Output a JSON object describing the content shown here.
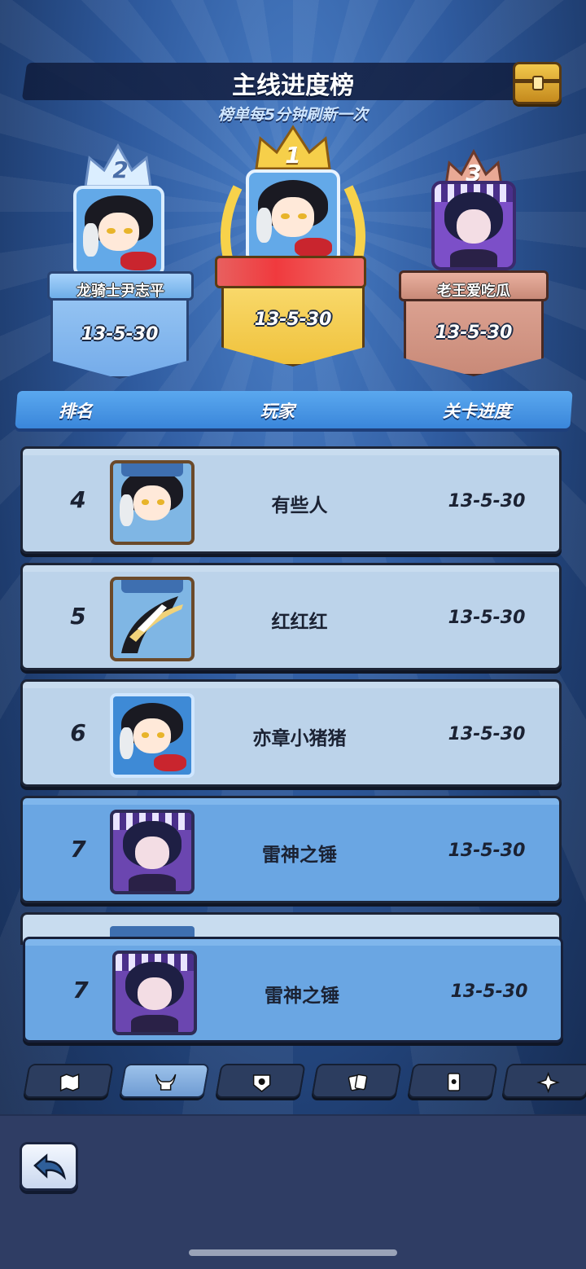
{
  "header": {
    "title": "主线进度榜",
    "subtitle": "榜单每5分钟刷新一次"
  },
  "podium": [
    {
      "rank": "1",
      "name": "",
      "progress": "13-5-30"
    },
    {
      "rank": "2",
      "name": "龙骑士尹志平",
      "progress": "13-5-30"
    },
    {
      "rank": "3",
      "name": "老王爱吃瓜",
      "progress": "13-5-30"
    }
  ],
  "table": {
    "columns": [
      "排名",
      "玩家",
      "关卡进度"
    ],
    "rows": [
      {
        "rank": "4",
        "name": "有些人",
        "progress": "13-5-30"
      },
      {
        "rank": "5",
        "name": "红红红",
        "progress": "13-5-30"
      },
      {
        "rank": "6",
        "name": "亦章小猪猪",
        "progress": "13-5-30"
      },
      {
        "rank": "7",
        "name": "雷神之锤",
        "progress": "13-5-30"
      }
    ]
  },
  "my_rank": {
    "rank": "7",
    "name": "雷神之锤",
    "progress": "13-5-30"
  },
  "tabs": [
    {
      "icon": "map-icon"
    },
    {
      "icon": "demon-horns-icon"
    },
    {
      "icon": "emblem-icon"
    },
    {
      "icon": "cards-icon"
    },
    {
      "icon": "card-icon"
    },
    {
      "icon": "sparkle-icon"
    }
  ],
  "active_tab": 1,
  "colors": {
    "accent": "#4a97e6",
    "gold": "#f6cf4a",
    "bronze": "#c98a78"
  }
}
